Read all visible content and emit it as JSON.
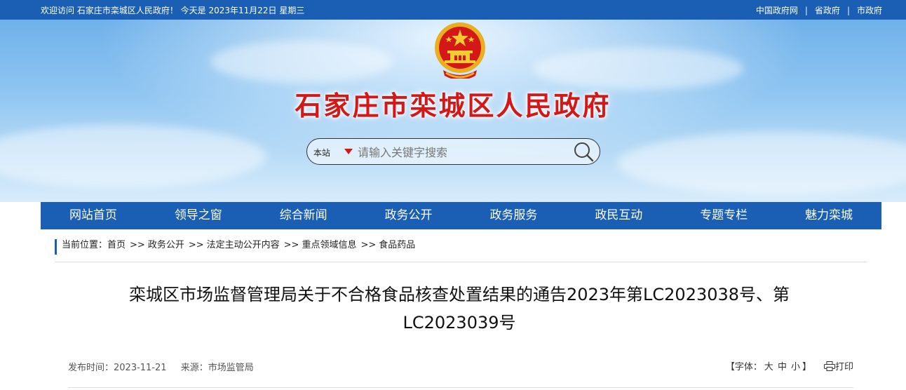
{
  "topbar": {
    "welcome": "欢迎访问 石家庄市栾城区人民政府！ 今天是  2023年11月22日 星期三",
    "links": [
      "中国政府网",
      "省政府",
      "市政府"
    ]
  },
  "header": {
    "site_title": "石家庄市栾城区人民政府",
    "search": {
      "scope": "本站",
      "placeholder": "请输入关键字搜索"
    }
  },
  "nav": [
    "网站首页",
    "领导之窗",
    "综合新闻",
    "政务公开",
    "政务服务",
    "政民互动",
    "专题专栏",
    "魅力栾城"
  ],
  "breadcrumb": {
    "prefix": "当前位置：",
    "items": [
      "首页",
      "政务公开",
      "法定主动公开内容",
      "重点领域信息",
      "食品药品"
    ],
    "separator": ">>"
  },
  "article": {
    "title": "栾城区市场监督管理局关于不合格食品核查处置结果的通告2023年第LC2023038号、第LC2023039号",
    "publish_time": "发布时间：2023-11-21",
    "source": "来源：市场监管局",
    "font_label_left": "【字体：",
    "font_sizes": [
      "大",
      "中",
      "小"
    ],
    "font_label_right": "】",
    "print_label": "打印"
  },
  "colors": {
    "primary_blue": "#1a5fb4",
    "title_red": "#d41818"
  }
}
